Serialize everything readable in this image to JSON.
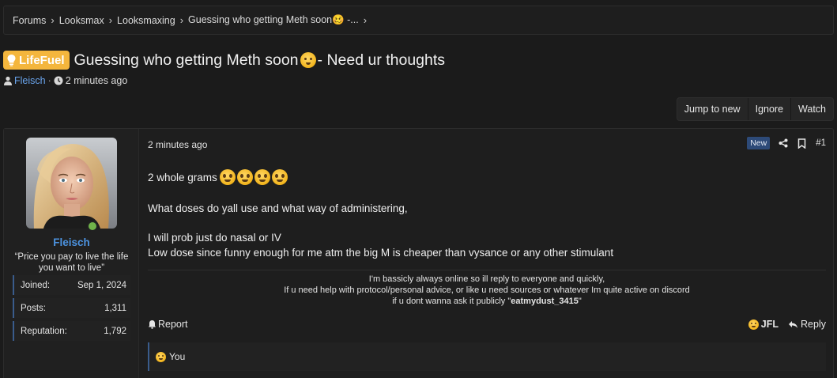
{
  "breadcrumbs": [
    "Forums",
    "Looksmax",
    "Looksmaxing",
    "Guessing who getting Meth soon🥴 -..."
  ],
  "thread": {
    "prefix": "LifeFuel",
    "title": "Guessing who getting Meth soon",
    "title_suffix": " - Need ur thoughts",
    "author": "Fleisch",
    "time": "2 minutes ago"
  },
  "actions": [
    "Jump to new",
    "Ignore",
    "Watch"
  ],
  "user": {
    "name": "Fleisch",
    "title": "“Price you pay to live the life you want to live”",
    "stats": [
      {
        "label": "Joined:",
        "value": "Sep 1, 2024"
      },
      {
        "label": "Posts:",
        "value": "1,311"
      },
      {
        "label": "Reputation:",
        "value": "1,792"
      }
    ]
  },
  "post": {
    "time": "2 minutes ago",
    "badge": "New",
    "number": "#1",
    "lines": [
      "2 whole grams",
      "What doses do yall use and what way of administering,",
      "I will prob just do nasal or IV",
      "Low dose since funny enough for me atm the big M is cheaper than vysance or any other stimulant"
    ]
  },
  "signature": {
    "line1": "I'm bassicly always online so ill reply to everyone and quickly,",
    "line2": "If u need help with protocol/personal advice, or like u need sources or whatever Im quite active on discord",
    "line3_prefix": "if u dont wanna ask it publicly \"",
    "line3_bold": "eatmydust_3415",
    "line3_suffix": "\""
  },
  "footer": {
    "report": "Report",
    "reaction": "JFL",
    "reply": "Reply"
  },
  "reactions": {
    "who": "You"
  },
  "colors": {
    "prefix_bg": "#f4b63d",
    "username": "#4c93e0",
    "online": "#70b34a",
    "new_badge": "#2d4a78"
  }
}
